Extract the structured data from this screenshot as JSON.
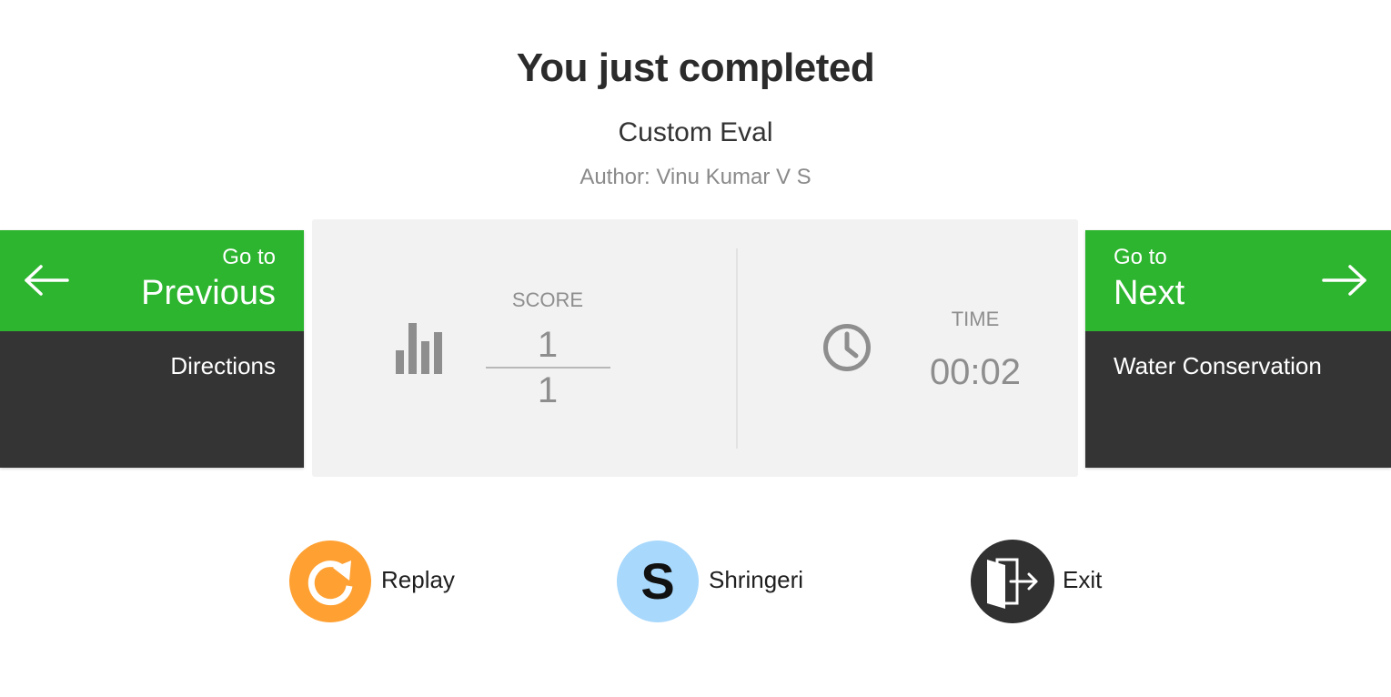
{
  "header": {
    "title": "You just completed",
    "activity_name": "Custom Eval",
    "author": "Author: Vinu Kumar V S"
  },
  "previous": {
    "goto_label": "Go to",
    "label": "Previous",
    "item": "Directions",
    "icon": "arrow-left-icon"
  },
  "next": {
    "goto_label": "Go to",
    "label": "Next",
    "item": "Water Conservation",
    "icon": "arrow-right-icon"
  },
  "stats": {
    "score_label": "SCORE",
    "score": "1",
    "score_total": "1",
    "time_label": "TIME",
    "time": "00:02",
    "score_icon": "bar-chart-icon",
    "time_icon": "clock-icon"
  },
  "actions": {
    "replay_label": "Replay",
    "user_initial": "S",
    "user_name": "Shringeri",
    "exit_label": "Exit"
  },
  "colors": {
    "accent_green": "#2db52f",
    "dark_panel": "#343434",
    "replay_orange": "#ffa032",
    "avatar_blue": "#a8d8fc",
    "exit_dark": "#313131",
    "stats_bg": "#f2f2f2"
  }
}
